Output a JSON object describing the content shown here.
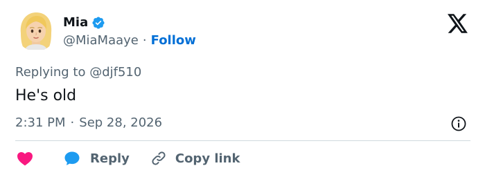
{
  "author": {
    "display_name": "Mia",
    "handle": "@MiaMaaye",
    "separator": "·",
    "follow_label": "Follow",
    "avatar_icon": "blonde-woman-emoji-avatar",
    "verified_icon": "verified-badge-icon"
  },
  "platform": {
    "logo_icon": "x-logo-icon"
  },
  "tweet": {
    "replying_to": "Replying to @djf510",
    "text": "He's old",
    "time": "2:31 PM",
    "separator": "·",
    "date": "Sep 28, 2026",
    "info_icon": "info-icon"
  },
  "actions": {
    "like_icon": "heart-icon",
    "reply_icon": "speech-bubble-icon",
    "reply_label": "Reply",
    "copy_icon": "link-icon",
    "copy_label": "Copy link"
  },
  "colors": {
    "accent": "#006fd6",
    "like": "#f91880",
    "verified": "#1d9bf0",
    "secondary_text": "#536471",
    "primary_text": "#0f1419",
    "divider": "#cfd9de"
  }
}
